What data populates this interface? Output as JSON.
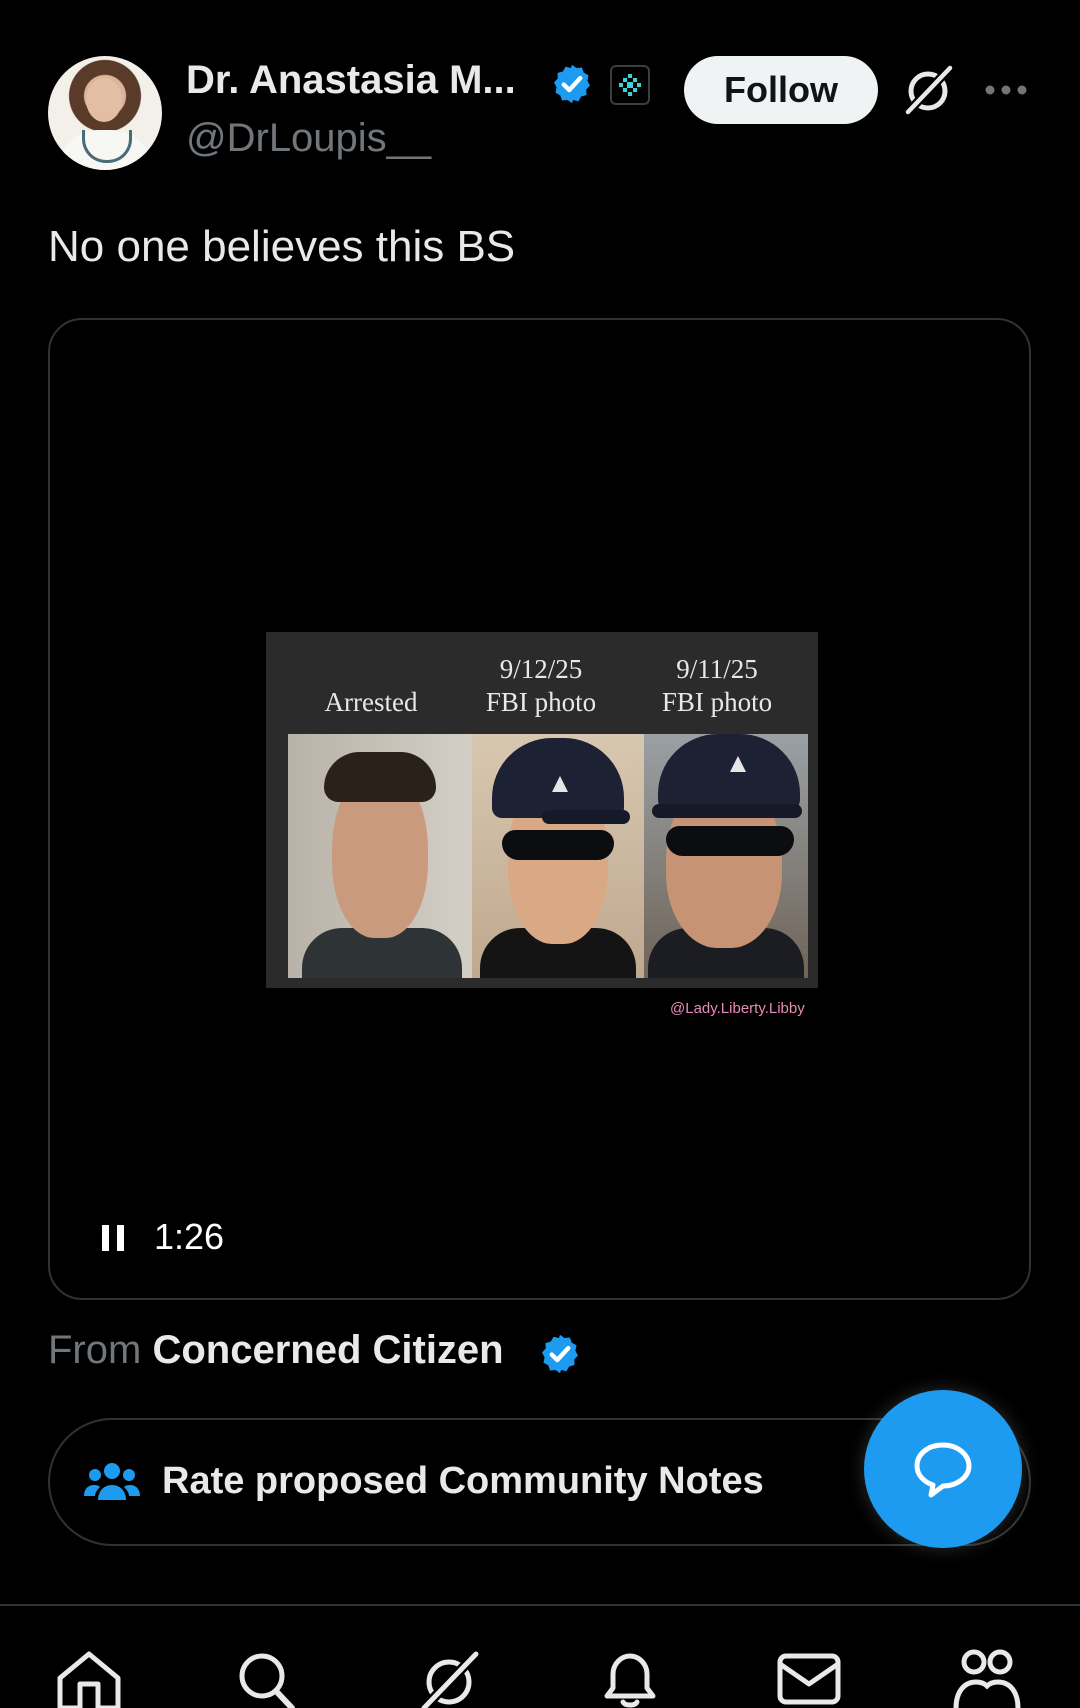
{
  "author": {
    "display_name": "Dr. Anastasia M...",
    "handle": "@DrLoupis__",
    "avatar_icon": "profile-photo",
    "verified_icon": "verified-badge-icon",
    "affiliation_icon": "affiliation-badge-icon"
  },
  "header_actions": {
    "follow_label": "Follow",
    "grok_icon": "grok-icon",
    "more_icon": "more-options-icon"
  },
  "tweet": {
    "text": "No one believes this BS"
  },
  "media": {
    "columns": [
      {
        "line1": "",
        "line2": "Arrested"
      },
      {
        "line1": "9/12/25",
        "line2": "FBI photo"
      },
      {
        "line1": "9/11/25",
        "line2": "FBI photo"
      }
    ],
    "watermark": "@Lady.Liberty.Libby",
    "duration": "1:26",
    "playback_state_icon": "pause-icon"
  },
  "source": {
    "prefix": "From",
    "name": "Concerned Citizen"
  },
  "community_notes": {
    "label": "Rate proposed Community Notes",
    "icon": "people-icon"
  },
  "fab": {
    "icon": "chat-bubble-icon"
  },
  "bottom_nav": [
    "home-icon",
    "search-icon",
    "grok-icon",
    "notifications-icon",
    "messages-icon",
    "communities-icon"
  ],
  "colors": {
    "background": "#000000",
    "accent_blue": "#1d9bf0",
    "text_primary": "#e7e9ea",
    "text_secondary": "#71767b",
    "border": "#2f3336",
    "watermark_pink": "#e88bb6"
  }
}
